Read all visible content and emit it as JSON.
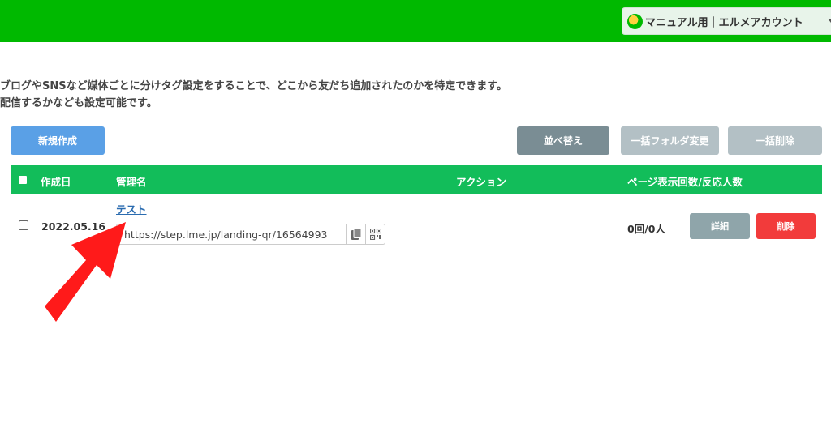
{
  "header": {
    "account_label": "マニュアル用｜エルメアカウント",
    "bar_color": "#00b900"
  },
  "description": {
    "line1": "ブログやSNSなど媒体ごとに分けタグ設定をすることで、どこから友だち追加されたのかを特定できます。",
    "line2": "配信するかなども設定可能です。"
  },
  "toolbar": {
    "new_label": "新規作成",
    "sort_label": "並べ替え",
    "bulk_folder_label": "一括フォルダ変更",
    "bulk_delete_label": "一括削除"
  },
  "table": {
    "columns": {
      "created": "作成日",
      "name": "管理名",
      "action": "アクション",
      "stats": "ページ表示回数/反応人数"
    },
    "rows": [
      {
        "date": "2022.05.16",
        "name": "テスト",
        "url": "https://step.lme.jp/landing-qr/16564993",
        "count": "0回/0人",
        "detail_label": "詳細",
        "delete_label": "削除"
      }
    ]
  },
  "annotation": {
    "arrow_color": "#ff1a1a",
    "arrow_icon": "red-pointer-arrow-icon"
  }
}
